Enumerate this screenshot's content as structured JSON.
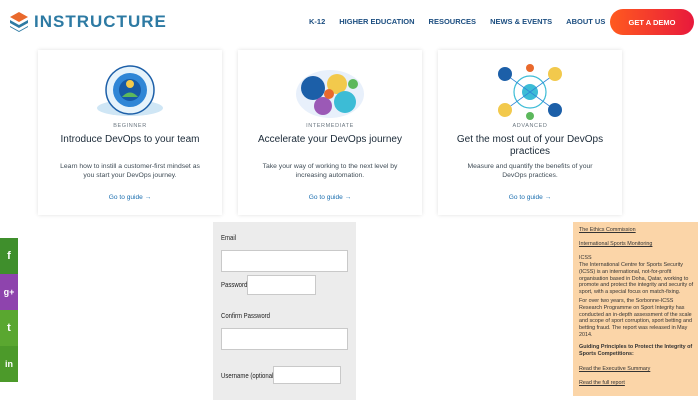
{
  "header": {
    "logo_text": "INSTRUCTURE",
    "nav": [
      "K-12",
      "HIGHER EDUCATION",
      "RESOURCES",
      "NEWS & EVENTS",
      "ABOUT US"
    ],
    "cta_label": "GET A DEMO"
  },
  "cards": [
    {
      "level": "BEGINNER",
      "title": "Introduce DevOps to your team",
      "description": "Learn how to instill a customer-first mindset as you start your DevOps journey.",
      "link": "Go to guide →"
    },
    {
      "level": "INTERMEDIATE",
      "title": "Accelerate your DevOps journey",
      "description": "Take your way of working to the next level by increasing automation.",
      "link": "Go to guide →"
    },
    {
      "level": "ADVANCED",
      "title": "Get the most out of your DevOps practices",
      "description": "Measure and quantify the benefits of your DevOps practices.",
      "link": "Go to guide →"
    }
  ],
  "social": [
    {
      "icon": "facebook-icon",
      "glyph": "f",
      "color": "#3a5a97"
    },
    {
      "icon": "google-plus-icon",
      "glyph": "g+",
      "color": "#8e44ad"
    },
    {
      "icon": "twitter-icon",
      "glyph": "t",
      "color": "#5aa730"
    },
    {
      "icon": "linkedin-icon",
      "glyph": "in",
      "color": "#4c9a2a"
    }
  ],
  "form": {
    "email_label": "Email",
    "password_label": "Password",
    "confirm_label": "Confirm Password",
    "username_label": "Username (optional)",
    "email_value": "",
    "password_value": "",
    "confirm_value": "",
    "username_value": ""
  },
  "article": {
    "heading_link": "The Ethics Commission",
    "sub_link": "International Sports Monitoring",
    "org_abbr": "ICSS",
    "para1": "The International Centre for Sports Security (ICSS) is an international, not-for-profit organisation based in Doha, Qatar, working to promote and protect the integrity and security of sport, with a special focus on match-fixing.",
    "para2": "For over two years, the Sorbonne-ICSS Research Programme on Sport Integrity has conducted an in-depth assessment of the scale and scope of sport corruption, sport betting and betting fraud. The report was released in May 2014.",
    "bold_heading": "Guiding Principles to Protect the Integrity of Sports Competitions:",
    "link1": "Read the Executive Summary",
    "link2": "Read the full report"
  },
  "colors": {
    "brand_blue": "#2d7aa3",
    "nav_blue": "#1c4e80",
    "cta_start": "#ff5a1f",
    "cta_end": "#e8193c",
    "link_blue": "#1c6fb0",
    "article_bg": "#fbd5a8"
  }
}
